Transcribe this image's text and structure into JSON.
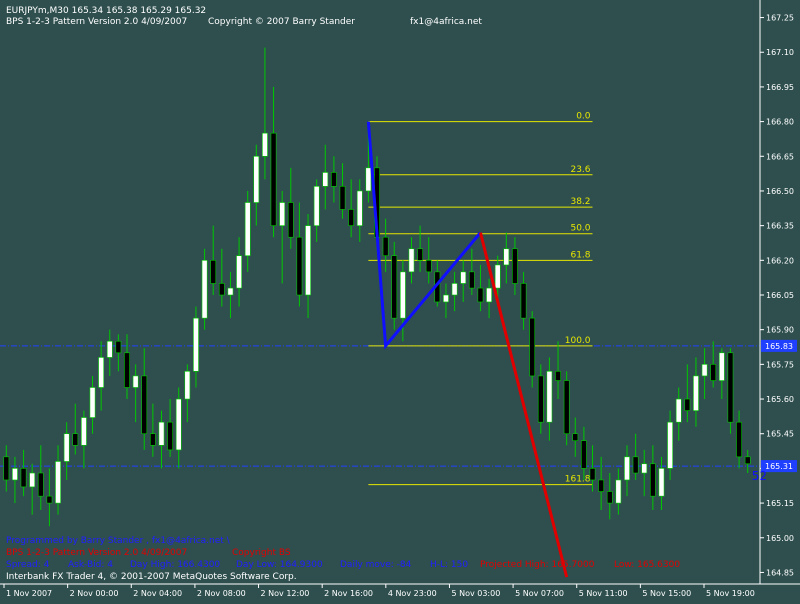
{
  "header": {
    "symbol_line": "EURJPYm,M30  165.34 165.38 165.29 165.32",
    "indicator_line": "BPS 1-2-3 Pattern  Version 2.0  4/09/2007",
    "copyright": "Copyright © 2007 Barry Stander",
    "email": "fx1@4africa.net"
  },
  "footer": {
    "programmed_by": "Programmed by Barry Stander ,  fx1@4africa.net  \\",
    "pattern_version": "BPS 1-2-3 Pattern  Version 2.0  4/09/2007",
    "copyright_short": "Copyright BS",
    "spread": "Spread:  4",
    "ask_bid": "Ask-Bid:  4",
    "day_high": "Day High:  166.4300",
    "day_low": "Day Low:  164.9300",
    "daily_move": "Daily move:  -84",
    "hl": "H-L:  150",
    "projected_high": "Projected High:  165.7000",
    "projected_low": "Low:  165.6300",
    "platform": "Interbank FX Trader 4, © 2001-2007 MetaQuotes Software Corp."
  },
  "colors": {
    "background": "#2f4f4f",
    "bull_candle": "#ffffff",
    "bear_candle": "#000000",
    "wick": "#00c800",
    "fib": "#e6e600",
    "pattern_blue": "#1010ff",
    "projection_red": "#e00000",
    "price_line": "#2040ff",
    "text": "#ffffff",
    "footer_blue": "#2020ff",
    "footer_red": "#e00000"
  },
  "chart_data": {
    "type": "candlestick",
    "symbol": "EURJPYm",
    "timeframe": "M30",
    "ylim": [
      164.8,
      167.3
    ],
    "y_ticks": [
      "167.25",
      "167.10",
      "166.95",
      "166.80",
      "166.65",
      "166.50",
      "166.35",
      "166.20",
      "166.05",
      "165.90",
      "165.75",
      "165.60",
      "165.45",
      "165.30",
      "165.15",
      "165.00",
      "164.85"
    ],
    "x_ticks": [
      "1 Nov 2007",
      "2 Nov 00:00",
      "2 Nov 04:00",
      "2 Nov 08:00",
      "2 Nov 12:00",
      "2 Nov 16:00",
      "4 Nov 23:00",
      "5 Nov 03:00",
      "5 Nov 07:00",
      "5 Nov 11:00",
      "5 Nov 15:00",
      "5 Nov 19:00"
    ],
    "current_price_label": "165.31",
    "level_label": "165.83",
    "levels": [
      165.83,
      165.31
    ],
    "last_bar_label": "52",
    "candles": [
      [
        165.35,
        165.4,
        165.2,
        165.25
      ],
      [
        165.25,
        165.35,
        165.15,
        165.3
      ],
      [
        165.3,
        165.38,
        165.18,
        165.22
      ],
      [
        165.22,
        165.32,
        165.1,
        165.28
      ],
      [
        165.28,
        165.4,
        165.12,
        165.18
      ],
      [
        165.18,
        165.3,
        165.05,
        165.15
      ],
      [
        165.15,
        165.4,
        165.1,
        165.33
      ],
      [
        165.33,
        165.5,
        165.25,
        165.45
      ],
      [
        165.45,
        165.58,
        165.36,
        165.4
      ],
      [
        165.4,
        165.55,
        165.3,
        165.52
      ],
      [
        165.52,
        165.7,
        165.45,
        165.65
      ],
      [
        165.65,
        165.85,
        165.55,
        165.78
      ],
      [
        165.78,
        165.9,
        165.7,
        165.85
      ],
      [
        165.85,
        165.88,
        165.72,
        165.8
      ],
      [
        165.8,
        165.88,
        165.6,
        165.65
      ],
      [
        165.65,
        165.75,
        165.5,
        165.7
      ],
      [
        165.7,
        165.82,
        165.38,
        165.45
      ],
      [
        165.45,
        165.58,
        165.35,
        165.4
      ],
      [
        165.4,
        165.55,
        165.3,
        165.5
      ],
      [
        165.5,
        165.6,
        165.35,
        165.38
      ],
      [
        165.38,
        165.65,
        165.3,
        165.6
      ],
      [
        165.6,
        165.75,
        165.5,
        165.72
      ],
      [
        165.72,
        166.0,
        165.65,
        165.95
      ],
      [
        165.95,
        166.25,
        165.9,
        166.2
      ],
      [
        166.2,
        166.35,
        166.05,
        166.1
      ],
      [
        166.1,
        166.25,
        166.0,
        166.05
      ],
      [
        166.05,
        166.15,
        165.95,
        166.08
      ],
      [
        166.08,
        166.3,
        166.0,
        166.22
      ],
      [
        166.22,
        166.5,
        166.15,
        166.45
      ],
      [
        166.45,
        166.7,
        166.35,
        166.65
      ],
      [
        166.65,
        167.12,
        166.55,
        166.75
      ],
      [
        166.75,
        166.95,
        166.3,
        166.35
      ],
      [
        166.35,
        166.5,
        166.1,
        166.45
      ],
      [
        166.45,
        166.6,
        166.25,
        166.3
      ],
      [
        166.3,
        166.45,
        166.0,
        166.05
      ],
      [
        166.05,
        166.4,
        165.95,
        166.35
      ],
      [
        166.35,
        166.55,
        166.28,
        166.52
      ],
      [
        166.52,
        166.7,
        166.42,
        166.58
      ],
      [
        166.58,
        166.65,
        166.45,
        166.52
      ],
      [
        166.52,
        166.62,
        166.38,
        166.42
      ],
      [
        166.42,
        166.55,
        166.3,
        166.35
      ],
      [
        166.35,
        166.55,
        166.28,
        166.5
      ],
      [
        166.5,
        166.8,
        166.45,
        166.6
      ],
      [
        166.6,
        166.65,
        166.25,
        166.3
      ],
      [
        166.3,
        166.38,
        166.15,
        166.22
      ],
      [
        166.22,
        166.28,
        165.9,
        165.95
      ],
      [
        165.95,
        166.2,
        165.85,
        166.15
      ],
      [
        166.15,
        166.3,
        166.1,
        166.25
      ],
      [
        166.25,
        166.35,
        166.15,
        166.2
      ],
      [
        166.2,
        166.3,
        166.1,
        166.15
      ],
      [
        166.15,
        166.2,
        166.0,
        166.02
      ],
      [
        166.02,
        166.1,
        165.95,
        166.05
      ],
      [
        166.05,
        166.15,
        165.98,
        166.1
      ],
      [
        166.1,
        166.2,
        166.02,
        166.15
      ],
      [
        166.15,
        166.25,
        166.05,
        166.08
      ],
      [
        166.08,
        166.18,
        165.98,
        166.02
      ],
      [
        166.02,
        166.12,
        165.95,
        166.08
      ],
      [
        166.08,
        166.22,
        166.02,
        166.18
      ],
      [
        166.18,
        166.32,
        166.1,
        166.25
      ],
      [
        166.25,
        166.3,
        166.05,
        166.1
      ],
      [
        166.1,
        166.15,
        165.9,
        165.95
      ],
      [
        165.95,
        165.98,
        165.65,
        165.7
      ],
      [
        165.7,
        165.75,
        165.45,
        165.5
      ],
      [
        165.5,
        165.78,
        165.42,
        165.72
      ],
      [
        165.72,
        165.85,
        165.6,
        165.68
      ],
      [
        165.68,
        165.72,
        165.4,
        165.45
      ],
      [
        165.45,
        165.52,
        165.35,
        165.42
      ],
      [
        165.42,
        165.48,
        165.25,
        165.3
      ],
      [
        165.3,
        165.4,
        165.2,
        165.25
      ],
      [
        165.25,
        165.35,
        165.12,
        165.2
      ],
      [
        165.2,
        165.28,
        165.08,
        165.15
      ],
      [
        165.15,
        165.3,
        165.1,
        165.25
      ],
      [
        165.25,
        165.4,
        165.18,
        165.35
      ],
      [
        165.35,
        165.45,
        165.25,
        165.28
      ],
      [
        165.28,
        165.38,
        165.18,
        165.32
      ],
      [
        165.32,
        165.4,
        165.12,
        165.18
      ],
      [
        165.18,
        165.35,
        165.12,
        165.3
      ],
      [
        165.3,
        165.55,
        165.25,
        165.5
      ],
      [
        165.5,
        165.65,
        165.42,
        165.6
      ],
      [
        165.6,
        165.75,
        165.5,
        165.55
      ],
      [
        165.55,
        165.78,
        165.48,
        165.7
      ],
      [
        165.7,
        165.82,
        165.6,
        165.75
      ],
      [
        165.75,
        165.85,
        165.65,
        165.68
      ],
      [
        165.68,
        165.82,
        165.6,
        165.8
      ],
      [
        165.8,
        165.82,
        165.45,
        165.5
      ],
      [
        165.5,
        165.55,
        165.3,
        165.35
      ],
      [
        165.35,
        165.38,
        165.28,
        165.32
      ]
    ],
    "pattern": [
      {
        "i": 42,
        "price": 166.8
      },
      {
        "i": 44,
        "price": 165.83
      },
      {
        "i": 55,
        "price": 166.32
      }
    ],
    "projection": [
      {
        "i": 55,
        "price": 166.32
      },
      {
        "i": 65,
        "price": 164.83
      }
    ],
    "fib_levels": [
      {
        "label": "0.0",
        "price": 166.8
      },
      {
        "label": "23.6",
        "price": 166.57
      },
      {
        "label": "38.2",
        "price": 166.43
      },
      {
        "label": "50.0",
        "price": 166.315
      },
      {
        "label": "61.8",
        "price": 166.2
      },
      {
        "label": "100.0",
        "price": 165.83
      },
      {
        "label": "161.8",
        "price": 165.23
      }
    ],
    "fib_line_x_start": 42,
    "fib_line_x_end": 68
  }
}
